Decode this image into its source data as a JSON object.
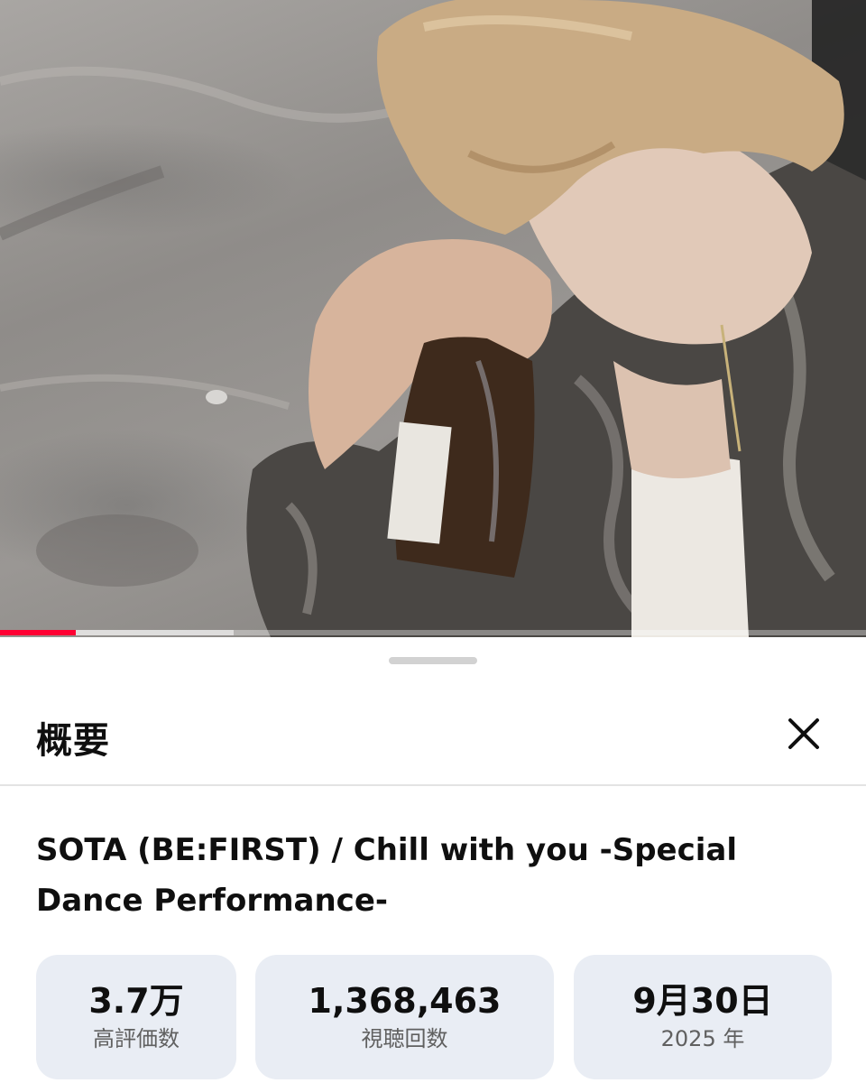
{
  "video": {
    "progress_fraction": 0.087,
    "buffer_fraction": 0.27,
    "accent_color": "#ff0033"
  },
  "sheet": {
    "title": "概要",
    "close_icon": "close-icon",
    "video_title": "SOTA (BE:FIRST) / Chill with you -Special Dance Performance-",
    "stats": [
      {
        "value": "3.7万",
        "label": "高評価数"
      },
      {
        "value": "1,368,463",
        "label": "視聴回数"
      },
      {
        "value": "9月30日",
        "label": "2025 年"
      }
    ]
  }
}
